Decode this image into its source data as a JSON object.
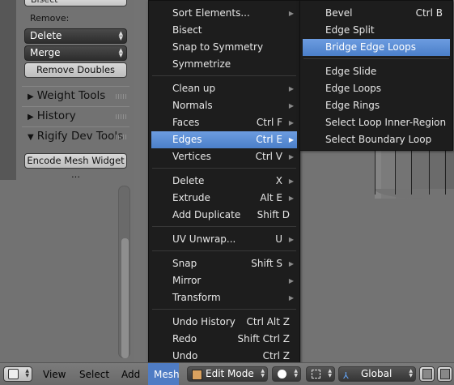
{
  "toolshelf": {
    "top_button_label": "Bisect",
    "remove_label": "Remove:",
    "delete_select": "Delete",
    "merge_select": "Merge",
    "remove_doubles_label": "Remove Doubles",
    "panels": [
      "Weight Tools",
      "History",
      "Rigify Dev Tools"
    ],
    "encode_button_label": "Encode Mesh Widget ..."
  },
  "mesh_menu": {
    "items": [
      {
        "label": "Sort Elements...",
        "shortcut": "",
        "submenu": true
      },
      {
        "label": "Bisect",
        "shortcut": "",
        "submenu": false
      },
      {
        "label": "Snap to Symmetry",
        "shortcut": "",
        "submenu": false
      },
      {
        "label": "Symmetrize",
        "shortcut": "",
        "submenu": false
      },
      {
        "label": "Clean up",
        "shortcut": "",
        "submenu": true
      },
      {
        "label": "Normals",
        "shortcut": "",
        "submenu": true
      },
      {
        "label": "Faces",
        "shortcut": "Ctrl F",
        "submenu": true
      },
      {
        "label": "Edges",
        "shortcut": "Ctrl E",
        "submenu": true
      },
      {
        "label": "Vertices",
        "shortcut": "Ctrl V",
        "submenu": true
      },
      {
        "label": "Delete",
        "shortcut": "X",
        "submenu": true
      },
      {
        "label": "Extrude",
        "shortcut": "Alt E",
        "submenu": true
      },
      {
        "label": "Add Duplicate",
        "shortcut": "Shift D",
        "submenu": false
      },
      {
        "label": "UV Unwrap...",
        "shortcut": "U",
        "submenu": true
      },
      {
        "label": "Snap",
        "shortcut": "Shift S",
        "submenu": true
      },
      {
        "label": "Mirror",
        "shortcut": "",
        "submenu": true
      },
      {
        "label": "Transform",
        "shortcut": "",
        "submenu": true
      },
      {
        "label": "Undo History",
        "shortcut": "Ctrl Alt Z",
        "submenu": false
      },
      {
        "label": "Redo",
        "shortcut": "Shift Ctrl Z",
        "submenu": false
      },
      {
        "label": "Undo",
        "shortcut": "Ctrl Z",
        "submenu": false
      }
    ]
  },
  "edges_menu": {
    "items": [
      {
        "label": "Bevel",
        "shortcut": "Ctrl B"
      },
      {
        "label": "Edge Split",
        "shortcut": ""
      },
      {
        "label": "Bridge Edge Loops",
        "shortcut": ""
      },
      {
        "label": "Edge Slide",
        "shortcut": ""
      },
      {
        "label": "Edge Loops",
        "shortcut": ""
      },
      {
        "label": "Edge Rings",
        "shortcut": ""
      },
      {
        "label": "Select Loop Inner-Region",
        "shortcut": ""
      },
      {
        "label": "Select Boundary Loop",
        "shortcut": ""
      }
    ]
  },
  "header": {
    "view": "View",
    "select": "Select",
    "add": "Add",
    "mesh": "Mesh",
    "mode": "Edit Mode",
    "orientation": "Global"
  },
  "colors": {
    "highlight": "#5b8dd6",
    "menu_bg": "#1d1d1d"
  }
}
